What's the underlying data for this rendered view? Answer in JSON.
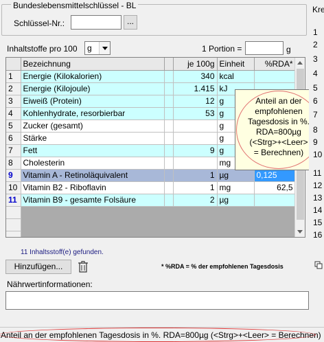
{
  "header": {
    "group_title": "Bundeslebensmittelschlüssel - BL",
    "key_label": "Schlüssel-Nr.:",
    "key_value": "",
    "browse_button": "..."
  },
  "filters": {
    "per_label": "Inhaltstoffe pro 100",
    "unit_value": "g",
    "portion_label": "1 Portion =",
    "portion_value": "",
    "portion_unit": "g"
  },
  "grid": {
    "columns": [
      "Bezeichnung",
      "je 100g",
      "Einheit",
      "%RDA*"
    ],
    "rows": [
      {
        "n": "1",
        "name": "Energie (Kilokalorien)",
        "val": "340",
        "unit": "kcal",
        "rda": ""
      },
      {
        "n": "2",
        "name": "Energie (Kilojoule)",
        "val": "1.415",
        "unit": "kJ",
        "rda": ""
      },
      {
        "n": "3",
        "name": "Eiweiß (Protein)",
        "val": "12",
        "unit": "g",
        "rda": ""
      },
      {
        "n": "4",
        "name": "Kohlenhydrate, resorbierbar",
        "val": "53",
        "unit": "g",
        "rda": ""
      },
      {
        "n": "5",
        "name": "Zucker (gesamt)",
        "val": "",
        "unit": "g",
        "rda": ""
      },
      {
        "n": "6",
        "name": "Stärke",
        "val": "",
        "unit": "g",
        "rda": ""
      },
      {
        "n": "7",
        "name": "Fett",
        "val": "9",
        "unit": "g",
        "rda": ""
      },
      {
        "n": "8",
        "name": "Cholesterin",
        "val": "",
        "unit": "mg",
        "rda": ""
      },
      {
        "n": "9",
        "name": "Vitamin A - Retinoläquivalent",
        "val": "1",
        "unit": "µg",
        "rda": "0,125"
      },
      {
        "n": "10",
        "name": "Vitamin B2 - Riboflavin",
        "val": "1",
        "unit": "mg",
        "rda": "62,5"
      },
      {
        "n": "11",
        "name": "Vitamin B9 - gesamte Folsäure",
        "val": "2",
        "unit": "µg",
        "rda": ""
      }
    ]
  },
  "status": {
    "found_text": "11  Inhaltsstoff(e) gefunden.",
    "rda_note": "* %RDA = % der empfohlenen Tagesdosis"
  },
  "actions": {
    "add_button": "Hinzufügen...",
    "nutrition_label": "Nährwertinformationen:"
  },
  "tooltip": {
    "lines": [
      "Anteil an der",
      "empfohlenen",
      "Tagesdosis in %.",
      "RDA=800µg",
      "(<Strg>+<Leer>",
      "= Berechnen)"
    ]
  },
  "right_panel": {
    "title": "Kre",
    "row_numbers": [
      "1",
      "2",
      "3",
      "4",
      "5",
      "6",
      "7",
      "8",
      "9",
      "10",
      "11",
      "12",
      "13",
      "14",
      "15",
      "16"
    ]
  },
  "statusbar": {
    "text": "Anteil an der empfohlenen Tagesdosis in %. RDA=800µg (<Strg>+<Leer> = Berechnen)"
  }
}
